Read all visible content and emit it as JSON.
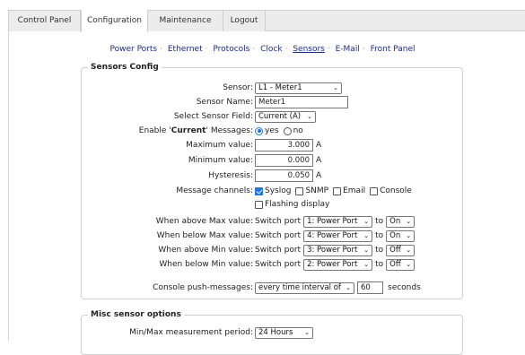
{
  "tabs": [
    "Control Panel",
    "Configuration",
    "Maintenance",
    "Logout"
  ],
  "subnav": [
    "Power Ports",
    "Ethernet",
    "Protocols",
    "Clock",
    "Sensors",
    "E-Mail",
    "Front Panel"
  ],
  "sensors_config": {
    "legend": "Sensors Config",
    "sensor_label": "Sensor:",
    "sensor_value": "L1 - Meter1",
    "sensor_name_label": "Sensor Name:",
    "sensor_name_value": "Meter1",
    "field_label": "Select Sensor Field:",
    "field_value": "Current (A)",
    "enable_prefix": "Enable '",
    "enable_bold": "Current",
    "enable_suffix": "' Messages:",
    "yes": "yes",
    "no": "no",
    "max_label": "Maximum value:",
    "max_value": "3.000",
    "min_label": "Minimum value:",
    "min_value": "0.000",
    "hyst_label": "Hysteresis:",
    "hyst_value": "0.050",
    "unit": "A",
    "channels_label": "Message channels:",
    "channels": {
      "syslog": "Syslog",
      "snmp": "SNMP",
      "email": "Email",
      "console": "Console",
      "flashing": "Flashing display"
    },
    "switch_word": "Switch port",
    "to_word": "to",
    "actions": [
      {
        "label": "When above Max value:",
        "port": "1: Power Port",
        "state": "On"
      },
      {
        "label": "When below Max value:",
        "port": "4: Power Port",
        "state": "On"
      },
      {
        "label": "When above Min value:",
        "port": "3: Power Port",
        "state": "Off"
      },
      {
        "label": "When below Min value:",
        "port": "2: Power Port",
        "state": "Off"
      }
    ],
    "push_label": "Console push-messages:",
    "push_value": "every time interval of",
    "push_interval": "60",
    "push_unit": "seconds"
  },
  "misc": {
    "legend": "Misc sensor options",
    "period_label": "Min/Max measurement period:",
    "period_value": "24 Hours"
  }
}
